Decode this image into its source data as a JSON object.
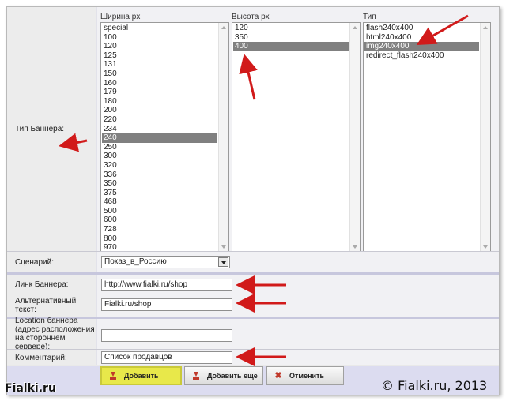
{
  "form": {
    "banner_type_label": "Тип Баннера:",
    "width_header": "Ширина px",
    "height_header": "Высота px",
    "type_header": "Тип",
    "width_options": [
      "special",
      "100",
      "120",
      "125",
      "131",
      "150",
      "160",
      "179",
      "180",
      "200",
      "220",
      "234",
      "240",
      "250",
      "300",
      "320",
      "336",
      "350",
      "375",
      "468",
      "500",
      "600",
      "728",
      "800",
      "970"
    ],
    "width_selected": "240",
    "height_options": [
      "120",
      "350",
      "400"
    ],
    "height_selected": "400",
    "type_options": [
      "flash240x400",
      "html240x400",
      "img240x400",
      "redirect_flash240x400"
    ],
    "type_selected": "img240x400",
    "scenario_label": "Сценарий:",
    "scenario_value": "Показ_в_Россию",
    "link_label": "Линк Баннера:",
    "link_value": "http://www.fialki.ru/shop",
    "alt_label": "Альтернативный текст:",
    "alt_value": "Fialki.ru/shop",
    "location_label": "Location баннера (адрес расположения на стороннем сервере):",
    "location_value": "",
    "comment_label": "Комментарий:",
    "comment_value": "Список продавцов"
  },
  "buttons": {
    "add": "Добавить",
    "add_more": "Добавить еще",
    "cancel": "Отменить"
  },
  "watermark": {
    "left": "Fialki.ru",
    "right": "© Fialki.ru, 2013"
  },
  "colors": {
    "highlight": "#e8e84a",
    "arrow": "#d11a1a",
    "selected_item": "#808080"
  }
}
